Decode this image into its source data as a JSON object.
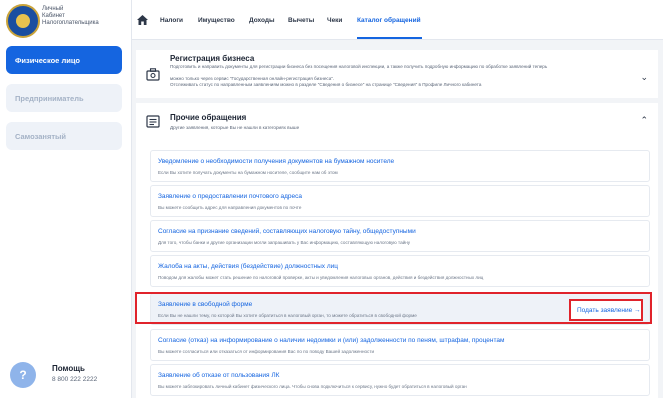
{
  "brand": {
    "line1": "Личный",
    "line2": "Кабинет",
    "line3": "Налогоплательщика"
  },
  "sidebar": {
    "items": [
      {
        "label": "Физическое лицо"
      },
      {
        "label": "Предприниматель"
      },
      {
        "label": "Самозанятый"
      }
    ],
    "help": {
      "title": "Помощь",
      "phone": "8 800 222 2222",
      "icon": "?"
    }
  },
  "topnav": {
    "items": [
      "Налоги",
      "Имущество",
      "Доходы",
      "Вычеты",
      "Чеки",
      "Каталог обращений"
    ]
  },
  "cards": {
    "business": {
      "title": "Регистрация бизнеса",
      "desc1": "Подготовить и направить документы для регистрации бизнеса без посещения налоговой инспекции, а также получить подробную информацию по обработке заявлений теперь",
      "desc2": "можно только через сервис \"Государственная онлайн-регистрация бизнеса\".",
      "desc3": "Отслеживать статус по направленным заявлениям можно в разделе \"Сведения о бизнесе\" на странице \"Сведения\" в Профиле Личного кабинета"
    },
    "other": {
      "title": "Прочие обращения",
      "desc": "Другие заявления, которые Вы не нашли в категориях выше"
    }
  },
  "requests": [
    {
      "title": "Уведомление о необходимости получения документов на бумажном носителе",
      "desc": "Если Вы хотите получать документы на бумажном носителе, сообщите нам об этом"
    },
    {
      "title": "Заявление о предоставлении почтового адреса",
      "desc": "Вы можете сообщить адрес для направления документов по почте"
    },
    {
      "title": "Согласие на признание сведений, составляющих налоговую тайну, общедоступными",
      "desc": "Для того, чтобы банки и другие организации могли запрашивать у Вас информацию, составляющую налоговую тайну"
    },
    {
      "title": "Жалоба на акты, действия (бездействие) должностных лиц",
      "desc": "Поводом для жалобы может стать решение по налоговой проверке, акты и уведомления налоговых органов, действия и бездействия должностных лиц"
    },
    {
      "title": "Заявление в свободной форме",
      "desc": "Если Вы не нашли тему, по которой Вы хотите обратиться в налоговый орган, то можете обратиться в свободной форме",
      "action": "Подать заявление →"
    },
    {
      "title": "Согласие (отказ) на информирование о наличии недоимки и (или) задолженности по пеням, штрафам, процентам",
      "desc": "Вы можете согласиться или отказаться от информирования Вас по по поводу Вашей задолженности"
    },
    {
      "title": "Заявление об отказе от пользования ЛК",
      "desc": "Вы можете заблокировать личный кабинет физического лица. Чтобы снова подключиться к сервису, нужно будет обратиться в налоговый орган"
    }
  ],
  "colors": {
    "accent": "#1565e0",
    "highlight_border": "#e0232b"
  }
}
